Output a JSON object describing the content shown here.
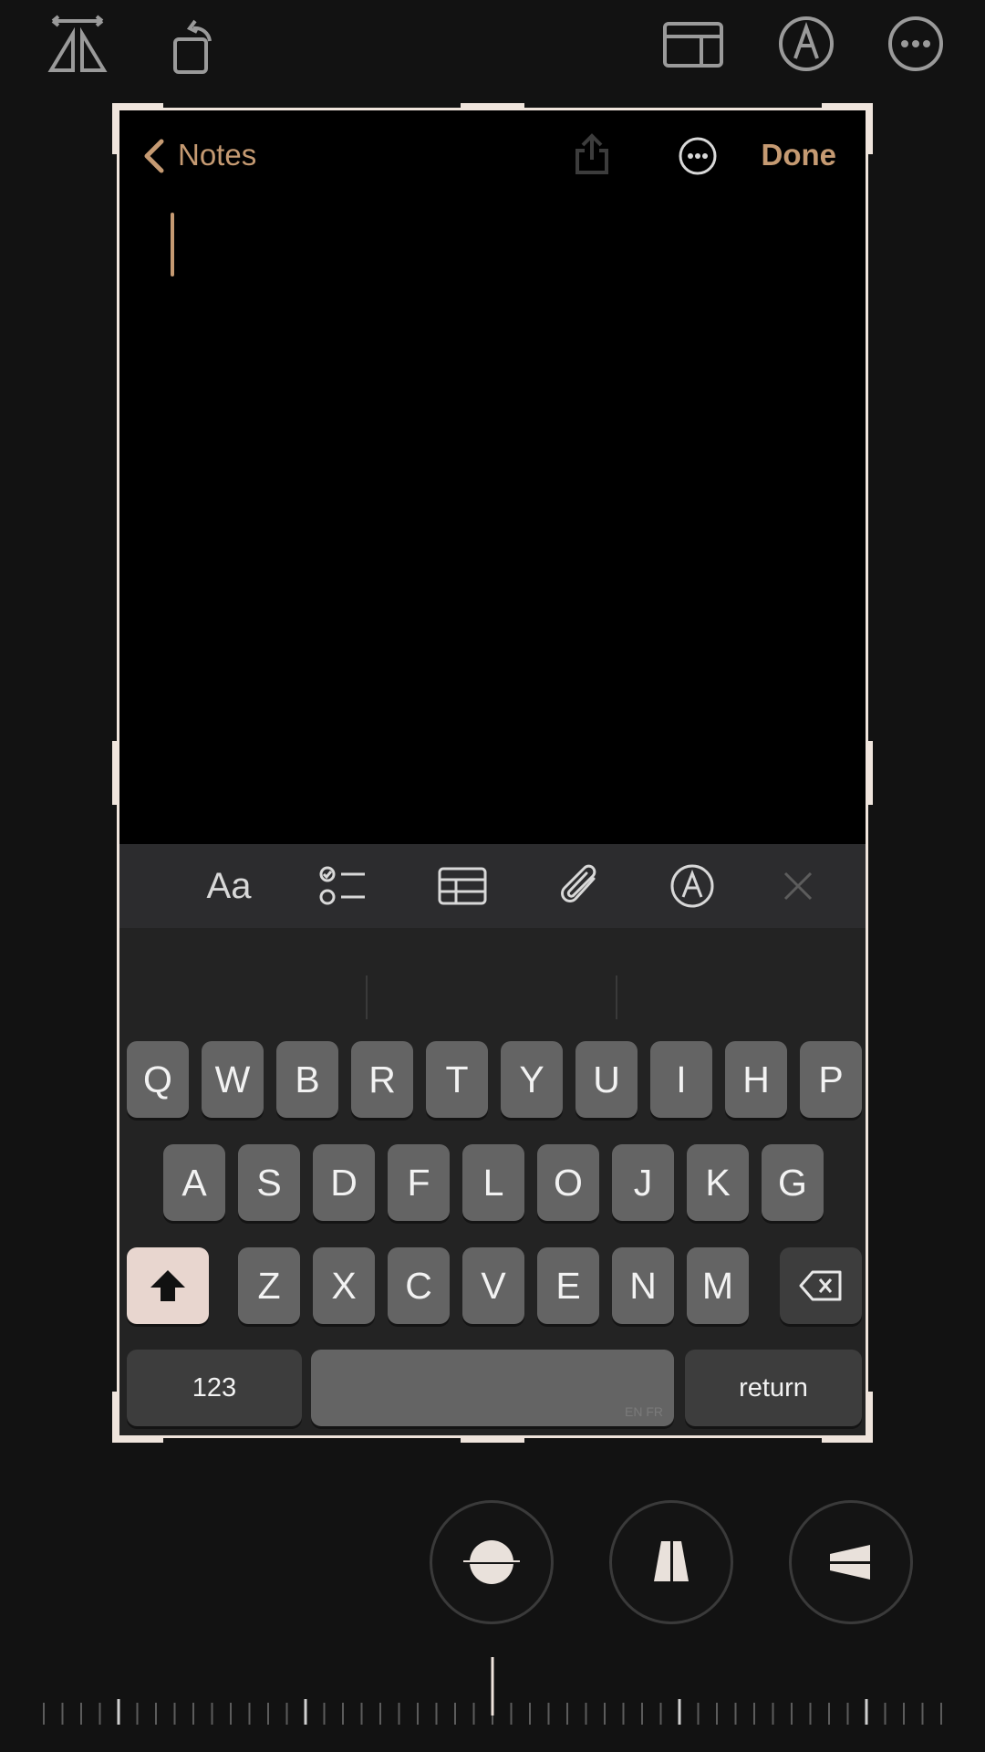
{
  "editor_toolbar": {
    "left_tools": [
      "flip-horizontal-icon",
      "rotate-icon"
    ],
    "right_tools": [
      "aspect-ratio-icon",
      "markup-icon",
      "more-icon"
    ]
  },
  "notes": {
    "back_label": "Notes",
    "done_label": "Done",
    "format_bar": {
      "text_style": "Aa",
      "icons": [
        "checklist-icon",
        "table-icon",
        "attachment-icon",
        "markup-pen-icon",
        "close-icon"
      ]
    }
  },
  "keyboard": {
    "row1": [
      "Q",
      "W",
      "B",
      "R",
      "T",
      "Y",
      "U",
      "I",
      "H",
      "P"
    ],
    "row2": [
      "A",
      "S",
      "D",
      "F",
      "L",
      "O",
      "J",
      "K",
      "G"
    ],
    "row3": [
      "Z",
      "X",
      "C",
      "V",
      "E",
      "N",
      "M"
    ],
    "numbers_label": "123",
    "space_lang": "EN FR",
    "return_label": "return"
  },
  "perspective_controls": [
    "straighten-icon",
    "vertical-perspective-icon",
    "horizontal-perspective-icon"
  ],
  "colors": {
    "accent": "#c59a72",
    "frame": "#efe4dc",
    "background": "#121212"
  }
}
